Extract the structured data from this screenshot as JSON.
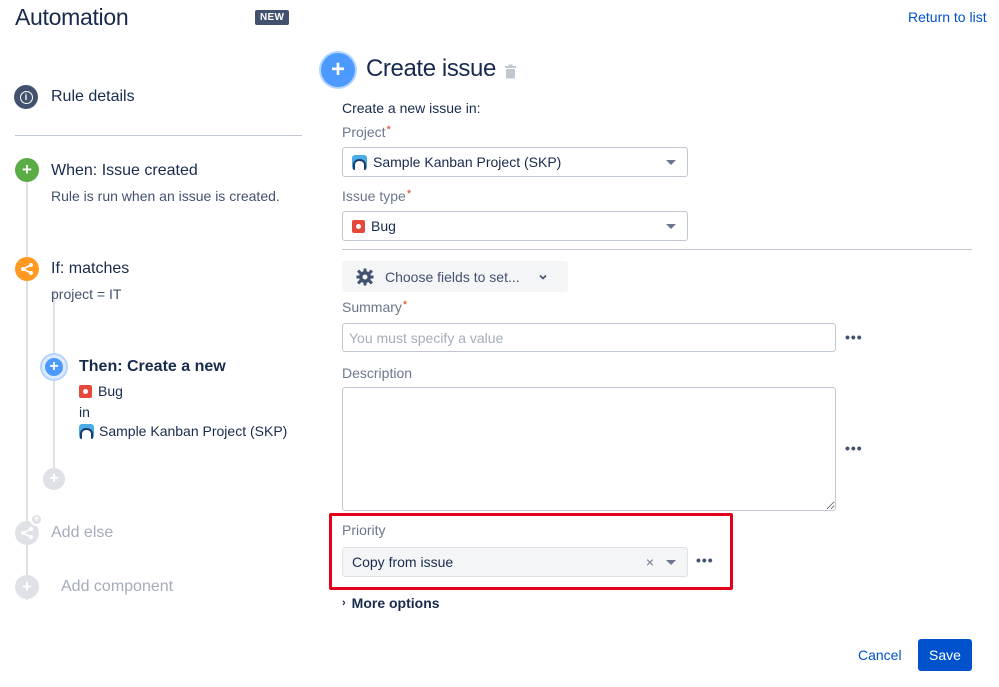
{
  "header": {
    "title": "Automation",
    "badge": "NEW",
    "return_link": "Return to list"
  },
  "sidebar": {
    "rule_details": "Rule details",
    "when": {
      "title": "When: Issue created",
      "subtitle": "Rule is run when an issue is created."
    },
    "if": {
      "title": "If: matches",
      "subtitle": "project = IT"
    },
    "then": {
      "title": "Then: Create a new",
      "issue_type": "Bug",
      "in_label": "in",
      "project": "Sample Kanban Project (SKP)"
    },
    "add_else": "Add else",
    "add_component": "Add component"
  },
  "panel": {
    "title": "Create issue",
    "create_in": "Create a new issue in:",
    "project": {
      "label": "Project",
      "required": "*",
      "value": "Sample Kanban Project (SKP)"
    },
    "issue_type": {
      "label": "Issue type",
      "required": "*",
      "value": "Bug"
    },
    "choose_fields": "Choose fields to set...",
    "summary": {
      "label": "Summary",
      "required": "*",
      "placeholder": "You must specify a value"
    },
    "description": {
      "label": "Description"
    },
    "priority": {
      "label": "Priority",
      "value": "Copy from issue",
      "clear": "×"
    },
    "more_dots": "•••",
    "more_options": "More options",
    "more_options_chevron": "›"
  },
  "footer": {
    "cancel": "Cancel",
    "save": "Save"
  },
  "colors": {
    "primary": "#0052cc",
    "trigger_green": "#5aac44",
    "condition_orange": "#ff991f",
    "action_blue": "#4c9aff",
    "highlight_red": "#e3001b",
    "bug_red": "#e5493a"
  }
}
